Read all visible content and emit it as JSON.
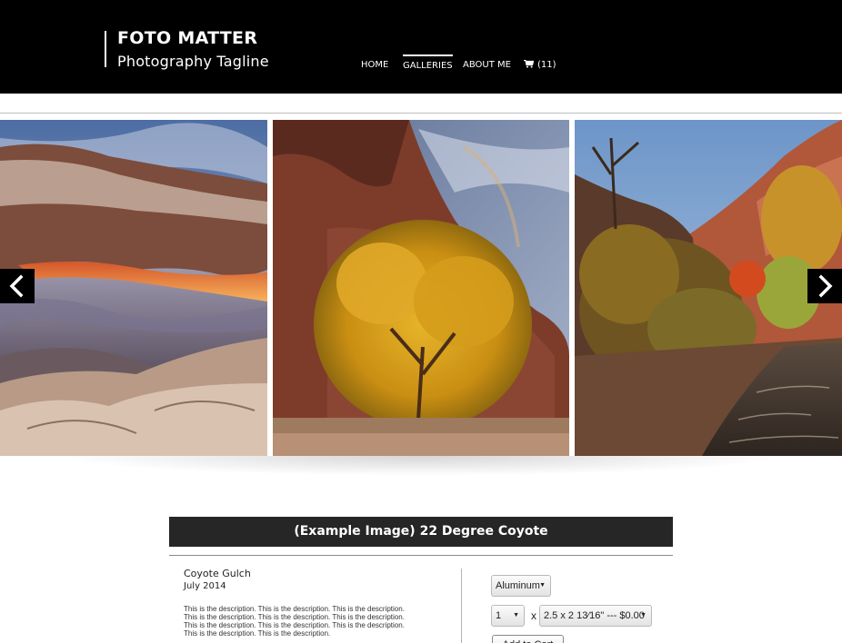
{
  "header": {
    "title": "FOTO MATTER",
    "tagline": "Photography Tagline",
    "background": "#000000"
  },
  "nav": {
    "items": [
      {
        "label": "HOME",
        "active": false
      },
      {
        "label": "GALLERIES",
        "active": true
      },
      {
        "label": "ABOUT ME",
        "active": false
      }
    ],
    "cart": {
      "icon": "shopping-cart-icon",
      "label": "(11)"
    }
  },
  "gallery": {
    "prev_icon": "chevron-left-icon",
    "next_icon": "chevron-right-icon",
    "slides": [
      {
        "name": "mesa-arch-photo"
      },
      {
        "name": "yellow-cottonwood-tree-photo"
      },
      {
        "name": "coyote-gulch-canyon-photo"
      }
    ]
  },
  "detail": {
    "title": "(Example Image) 22 Degree Coyote",
    "location": "Coyote Gulch",
    "date": "July 2014",
    "description_lines": [
      "This is the description. This is the description. This is the description.",
      "This is the description. This is the description. This is the description.",
      "This is the description. This is the description. This is the description.",
      "This is the description. This is the description."
    ]
  },
  "purchase": {
    "material": "Aluminum",
    "quantity": "1",
    "times": "x",
    "size_price": "2.5 x 2 13⁄16\" --- $0.00",
    "add_to_cart": "Add to Cart"
  },
  "colors": {
    "title_bar": "#262626",
    "arrow_bg": "#000000"
  }
}
